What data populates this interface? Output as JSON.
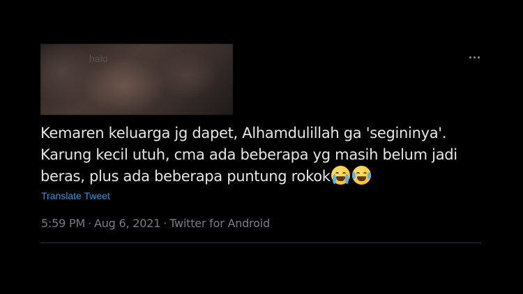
{
  "header": {
    "blurred_name": "halo",
    "more_icon": "more-horizontal-icon"
  },
  "tweet": {
    "lines": [
      "Kemaren keluarga jg dapet, Alhamdulillah ga 'segininya'.",
      "Karung kecil utuh, cma ada beberapa yg masih belum jadi",
      "beras, plus ada beberapa puntung rokok"
    ],
    "emojis": [
      "loudly-crying-face-emoji",
      "face-with-tears-of-joy-emoji"
    ],
    "translate_label": "Translate Tweet"
  },
  "meta": {
    "time": "5:59 PM",
    "date": "Aug 6, 2021",
    "source": "Twitter for Android",
    "separator": "·"
  },
  "colors": {
    "background": "#000000",
    "text": "#e6e6e6",
    "link": "#1d9bf0",
    "muted": "#787c82",
    "divider": "#2f3336"
  }
}
